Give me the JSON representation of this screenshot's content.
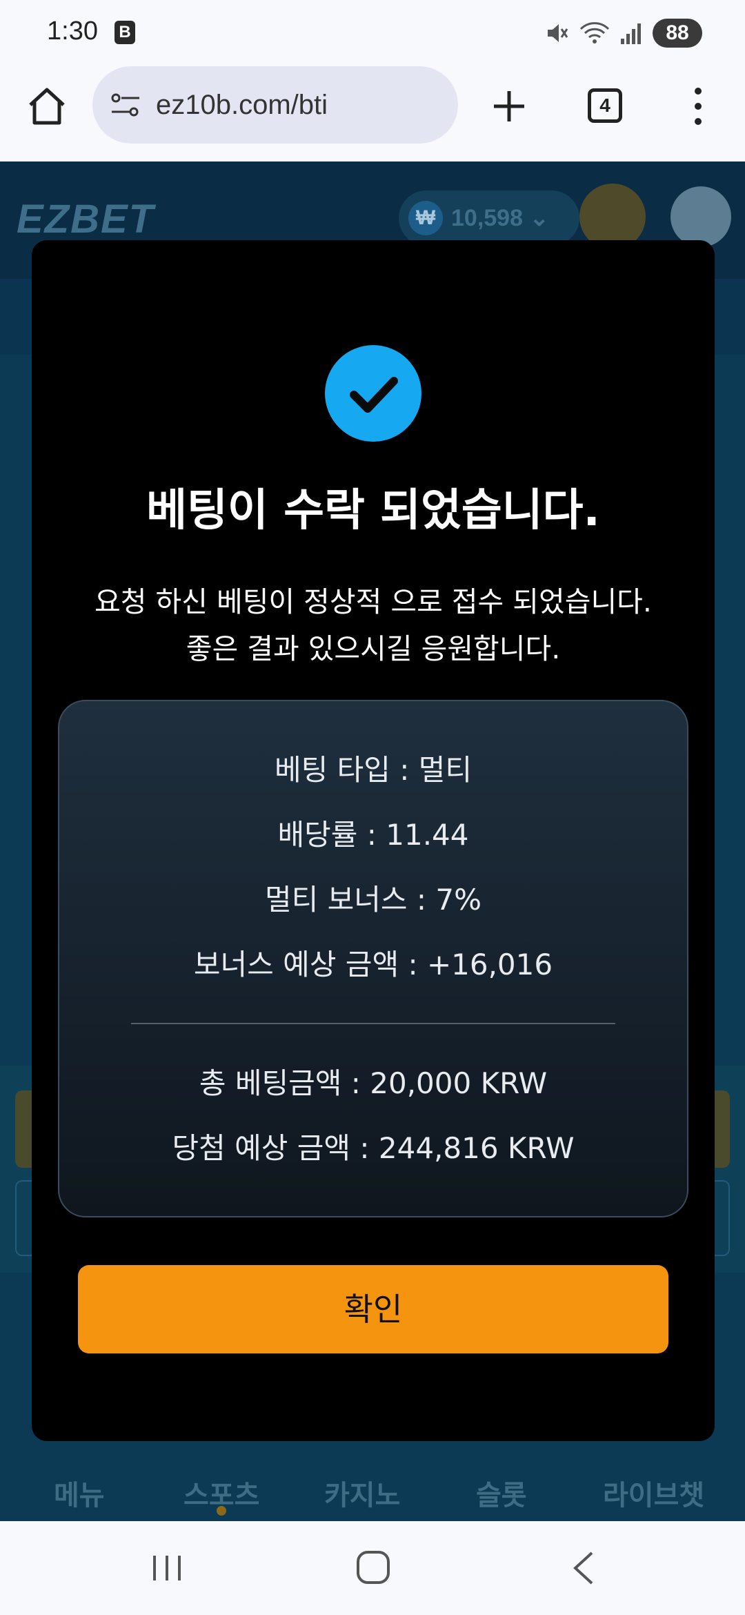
{
  "status_bar": {
    "time": "1:30",
    "app_icon_letter": "B",
    "battery": "88"
  },
  "browser": {
    "url": "ez10b.com/bti",
    "tab_count": "4"
  },
  "site": {
    "logo": "EZBET",
    "currency_symbol": "₩",
    "balance": "10,598 ⌄",
    "bottom_nav": [
      "메뉴",
      "스포츠",
      "카지노",
      "슬롯",
      "라이브챗"
    ]
  },
  "modal": {
    "title": "베팅이 수락 되었습니다.",
    "subtitle": "요청 하신 베팅이 정상적 으로 접수 되었습니다. 좋은 결과 있으시길 응원합니다.",
    "rows": [
      "베팅 타입 :  멀티",
      "배당률 :  11.44",
      "멀티 보너스 :  7%",
      "보너스 예상 금액 :  +16,016"
    ],
    "total_rows": [
      "총 베팅금액 :  20,000 KRW",
      "당첨 예상 금액 :  244,816 KRW"
    ],
    "confirm_label": "확인"
  },
  "colors": {
    "accent": "#16a8f0",
    "button": "#f5940e",
    "modal_bg": "#000000"
  }
}
